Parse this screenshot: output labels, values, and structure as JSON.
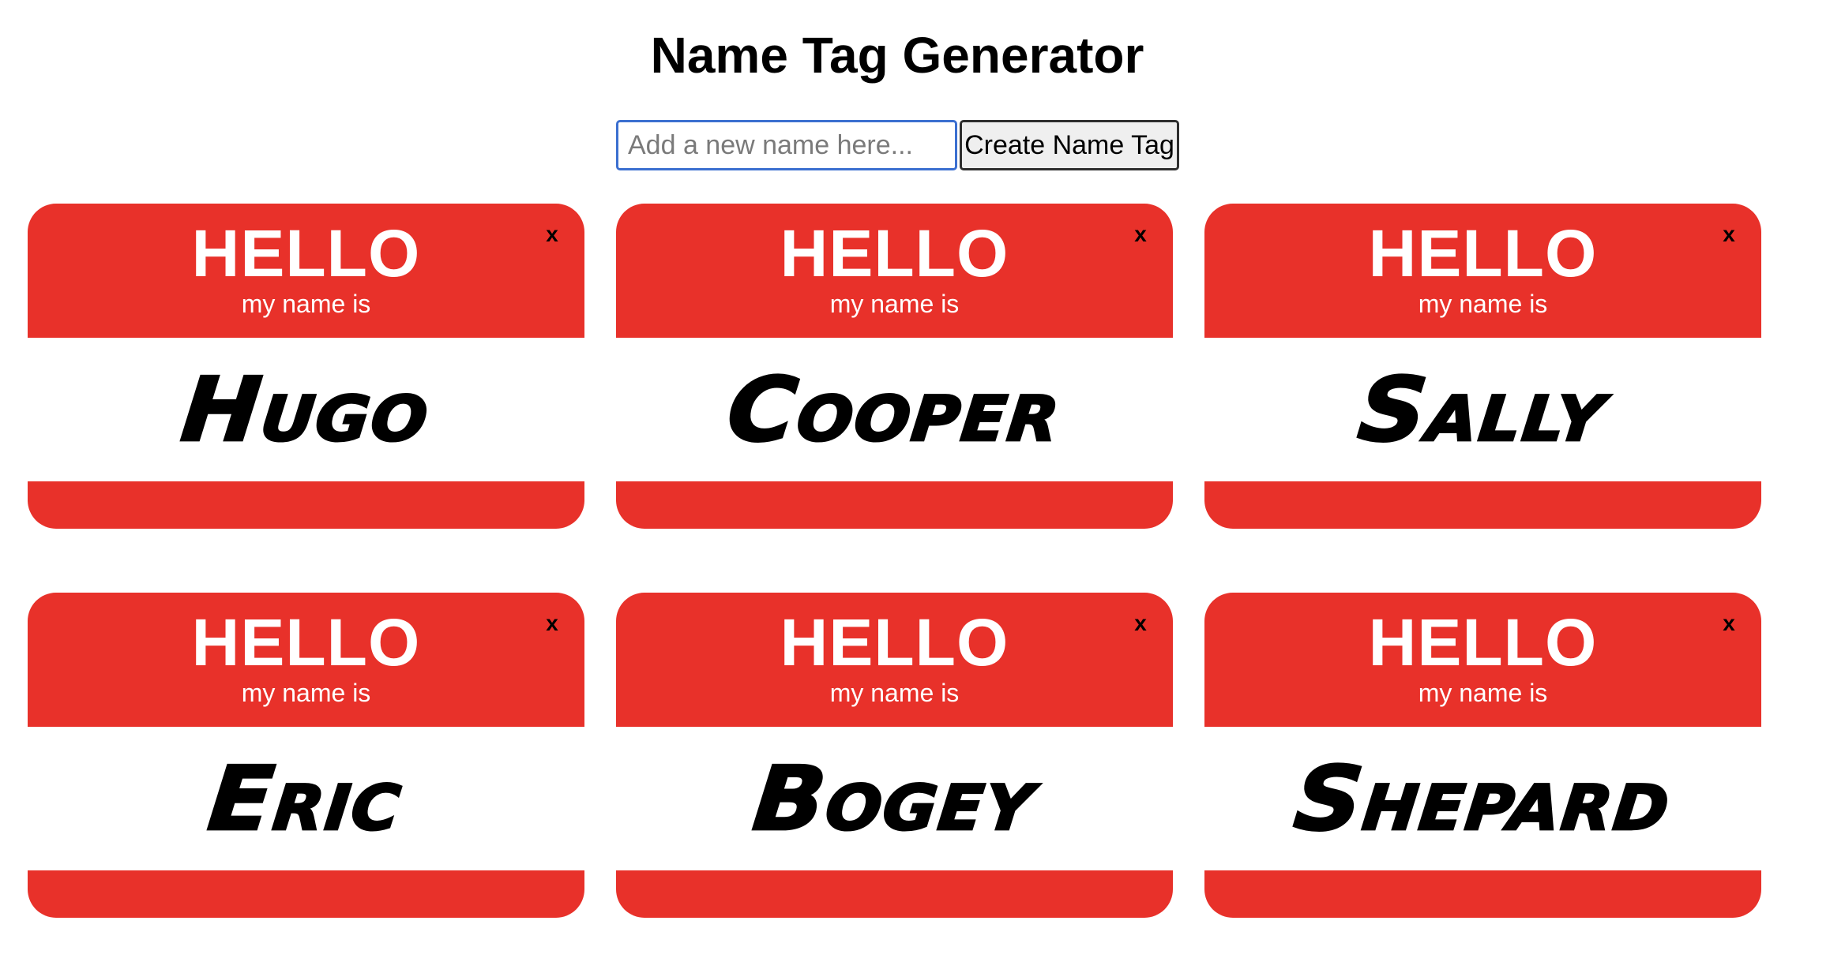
{
  "header": {
    "title": "Name Tag Generator"
  },
  "form": {
    "input_placeholder": "Add a new name here...",
    "input_value": "",
    "create_label": "Create Name Tag"
  },
  "tag_template": {
    "hello": "HELLO",
    "subtitle": "my name is",
    "close_label": "x"
  },
  "tags": [
    {
      "name": "Hugo"
    },
    {
      "name": "Cooper"
    },
    {
      "name": "Sally"
    },
    {
      "name": "Eric"
    },
    {
      "name": "Bogey"
    },
    {
      "name": "Shepard"
    }
  ],
  "colors": {
    "tag_red": "#e8312a",
    "input_focus_border": "#3b6fd0",
    "button_bg": "#efefef"
  }
}
